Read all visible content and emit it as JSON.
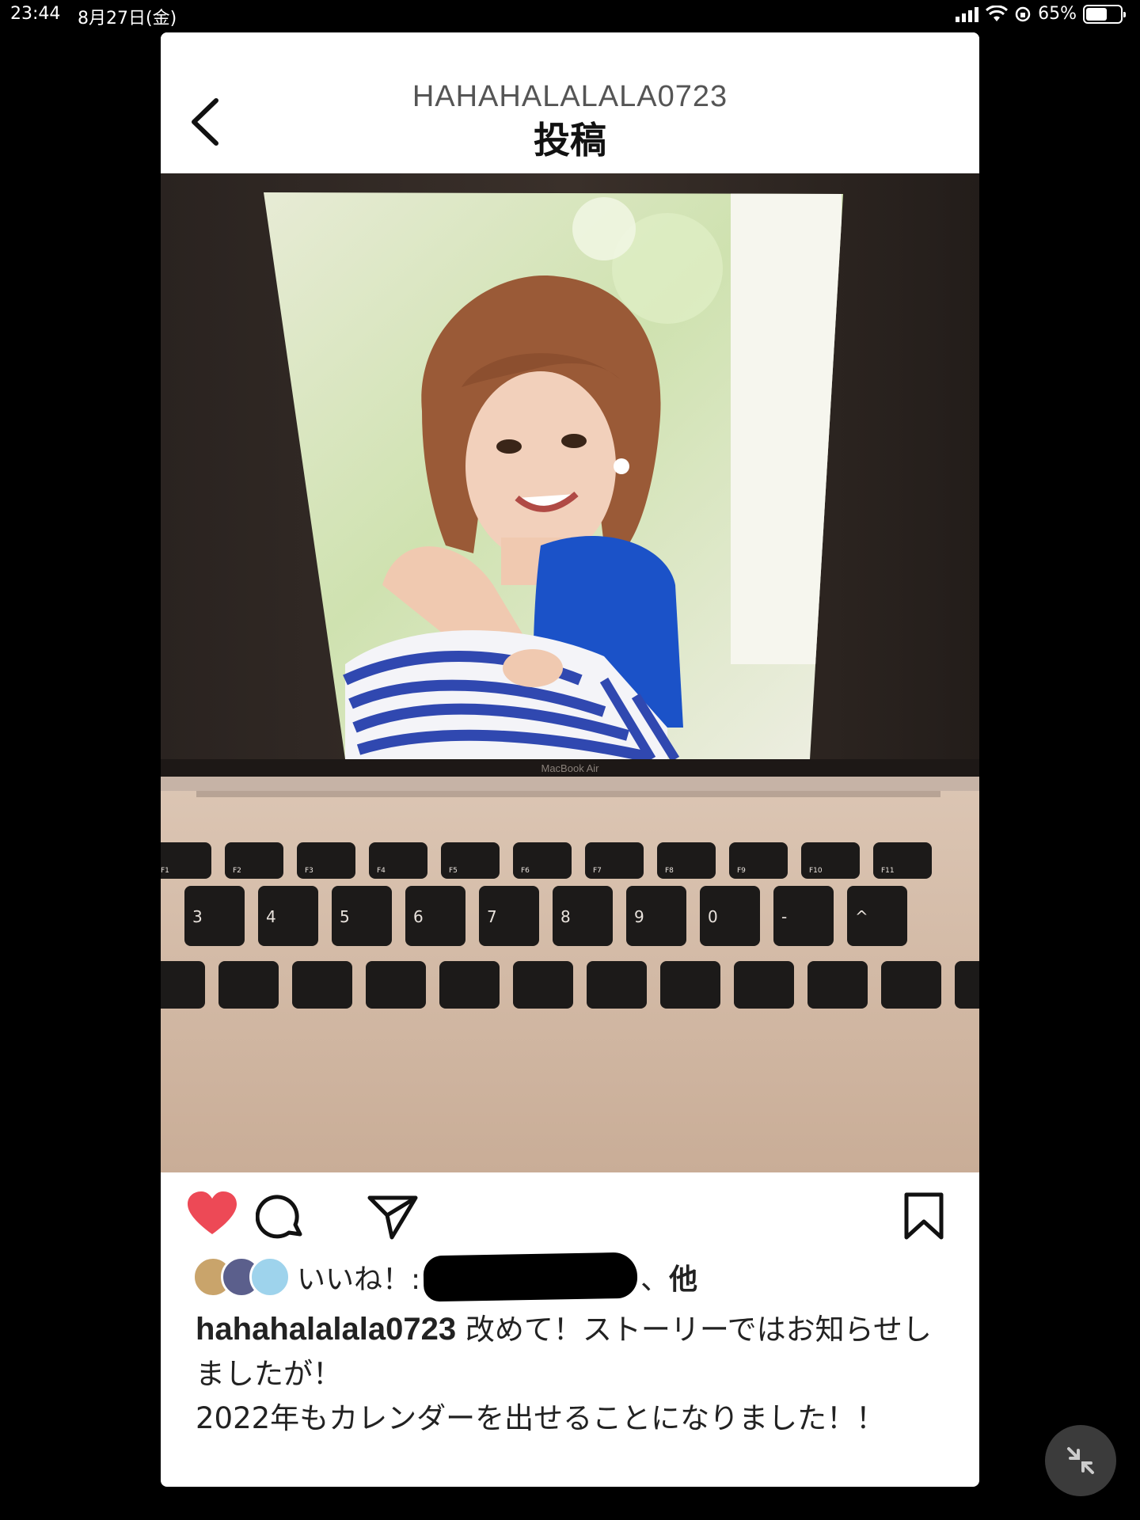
{
  "status_bar": {
    "time": "23:44",
    "date": "8月27日(金)",
    "battery": "65%",
    "battery_level": 0.65
  },
  "header": {
    "username": "HAHAHALALALA0723",
    "title": "投稿"
  },
  "post_image": {
    "laptop_label": "MacBook Air",
    "keys_row1": [
      "F1",
      "F2",
      "F3",
      "F4",
      "F5",
      "F6",
      "F7",
      "F8",
      "F9",
      "F10",
      "F11"
    ],
    "keys_row2": [
      "3",
      "4",
      "5",
      "6",
      "7",
      "8",
      "9",
      "0",
      "-",
      "^"
    ]
  },
  "likes": {
    "prefix": "いいね！:",
    "suffix": "、",
    "others": "他"
  },
  "caption": {
    "username": "hahahalalala0723",
    "line1": " 改めて！ストーリーではお知らせしましたが！",
    "line2": "2022年もカレンダーを出せることになりました！！"
  },
  "colors": {
    "heart": "#ED4956",
    "page_bg": "#000000",
    "card_bg": "#FFFFFF"
  }
}
